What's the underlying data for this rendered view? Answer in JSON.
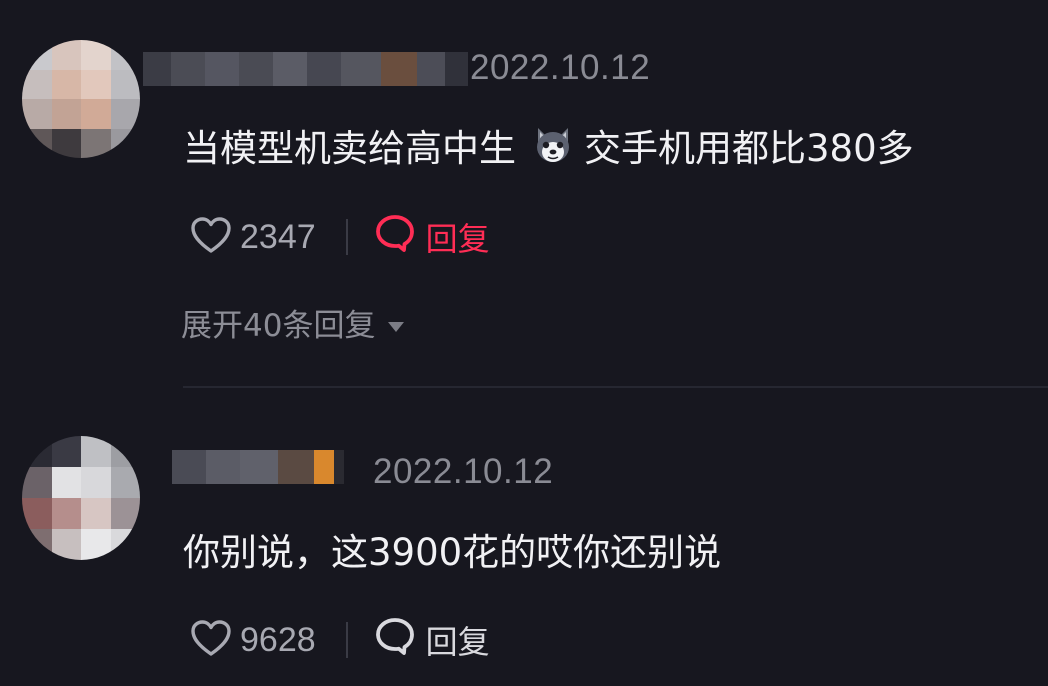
{
  "comments": [
    {
      "date": "2022.10.12",
      "text_before_emoji": "当模型机卖给高中生",
      "emoji": "husky-face-emoji",
      "text_after_emoji": "交手机用都比380多",
      "likes": "2347",
      "reply_label": "回复",
      "reply_color": "#ff2d55",
      "expand_label": "展开40条回复",
      "expand_icon": "triangle-down-icon"
    },
    {
      "date": "2022.10.12",
      "text": "你别说，这3900花的哎你还别说",
      "likes": "9628",
      "reply_label": "回复",
      "reply_color": "#d9d9de"
    }
  ]
}
